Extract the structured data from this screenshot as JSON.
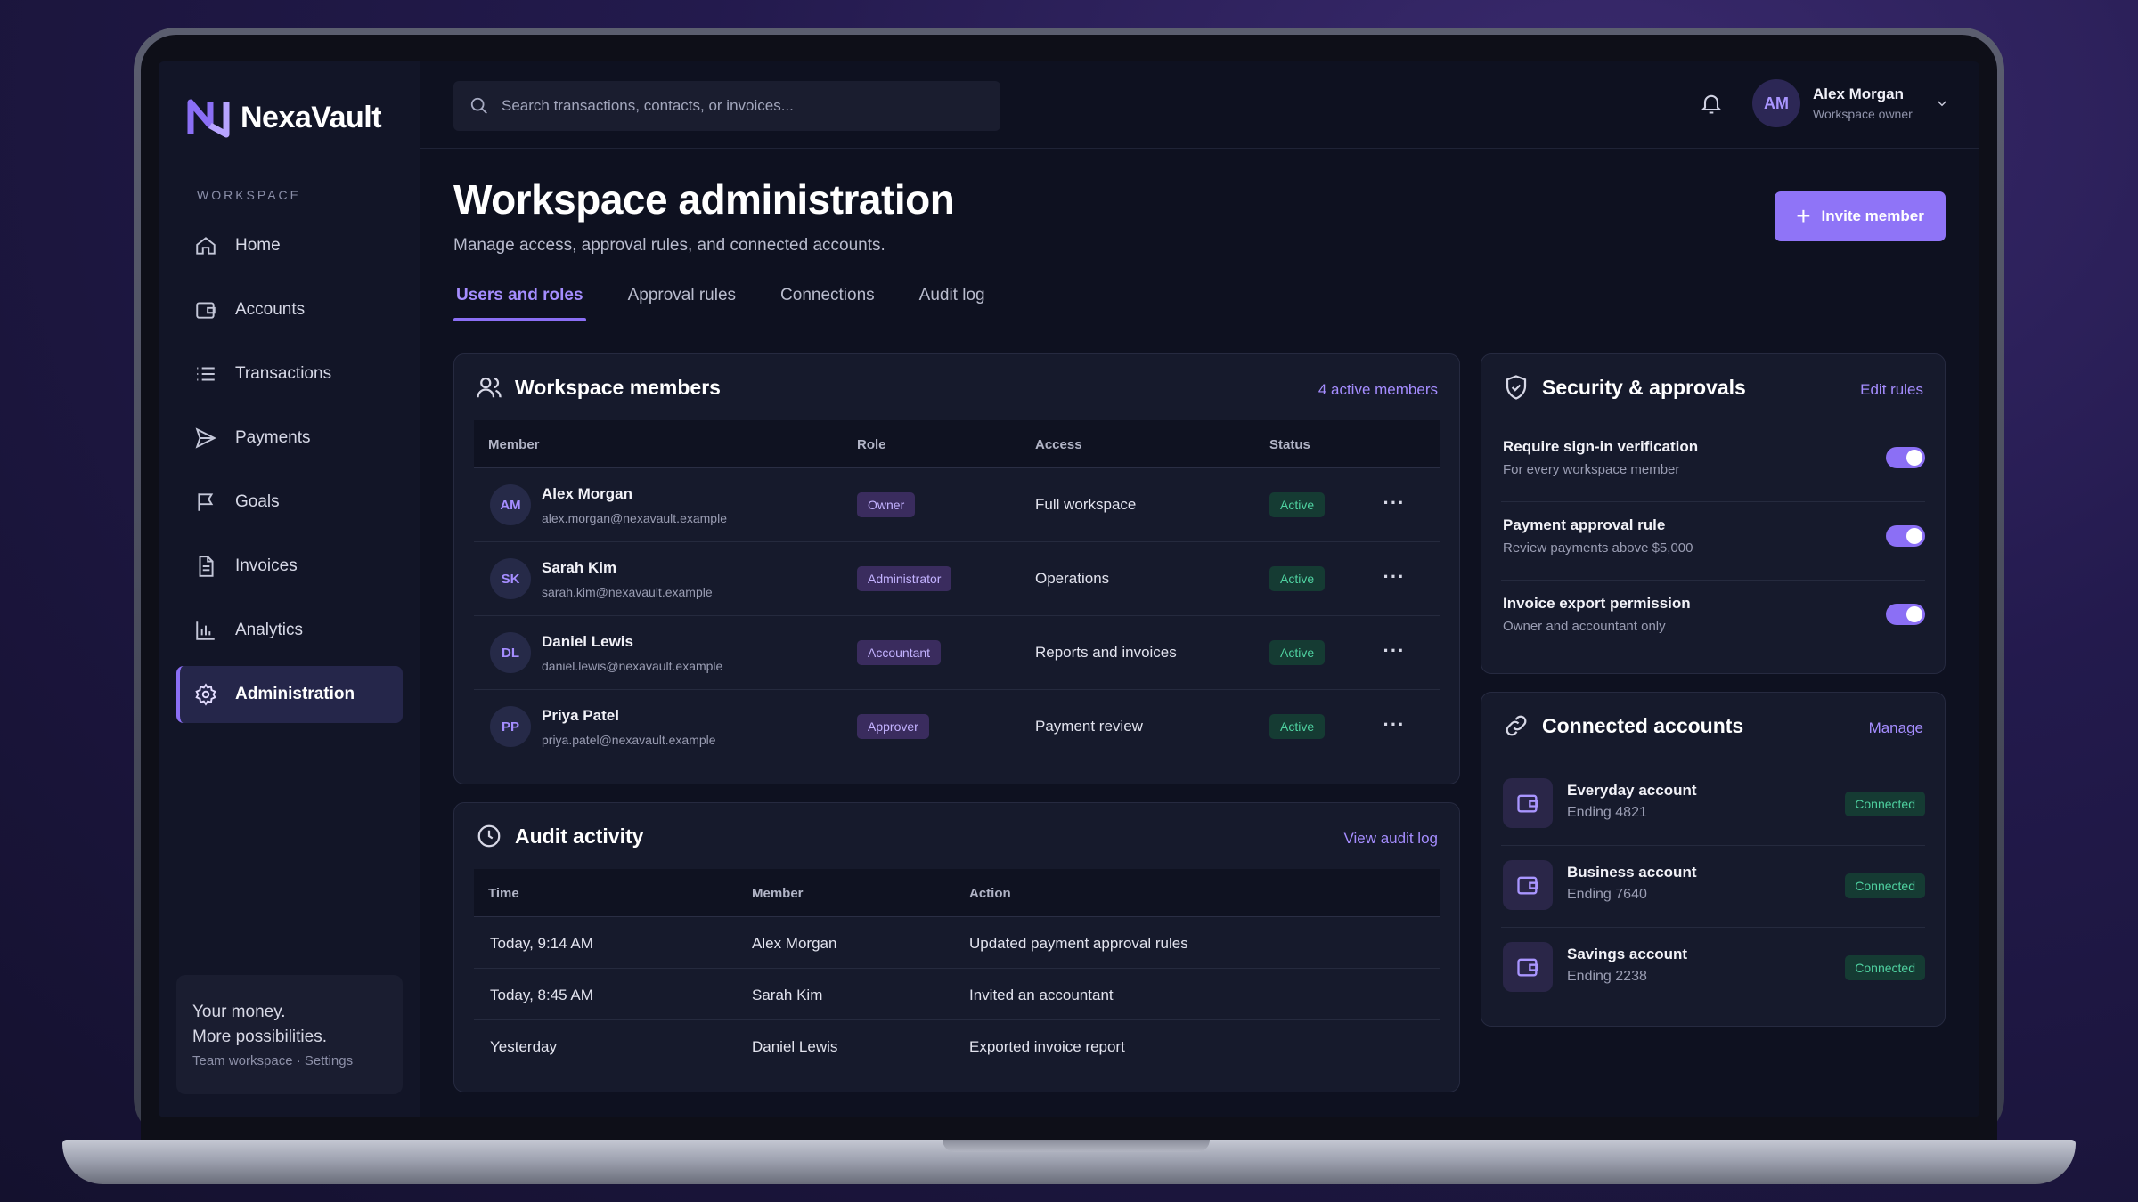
{
  "brand": {
    "name": "NexaVault"
  },
  "sidebar": {
    "section_label": "WORKSPACE",
    "items": [
      {
        "label": "Home",
        "icon": "home-icon"
      },
      {
        "label": "Accounts",
        "icon": "wallet-icon"
      },
      {
        "label": "Transactions",
        "icon": "list-icon"
      },
      {
        "label": "Payments",
        "icon": "send-icon"
      },
      {
        "label": "Goals",
        "icon": "flag-icon"
      },
      {
        "label": "Invoices",
        "icon": "document-icon"
      },
      {
        "label": "Analytics",
        "icon": "bar-chart-icon"
      },
      {
        "label": "Administration",
        "icon": "gear-icon",
        "active": true
      }
    ],
    "footer": {
      "line1": "Your money.",
      "line2": "More possibilities.",
      "line3": "Team workspace · Settings"
    }
  },
  "topbar": {
    "search_placeholder": "Search transactions, contacts, or invoices...",
    "user": {
      "initials": "AM",
      "name": "Alex Morgan",
      "role": "Workspace owner"
    }
  },
  "page": {
    "title": "Workspace administration",
    "subtitle": "Manage access, approval rules, and connected accounts.",
    "invite_label": "Invite member",
    "tabs": [
      {
        "label": "Users and roles",
        "active": true
      },
      {
        "label": "Approval rules"
      },
      {
        "label": "Connections"
      },
      {
        "label": "Audit log"
      }
    ]
  },
  "members": {
    "title": "Workspace members",
    "count_link": "4 active members",
    "columns": [
      "Member",
      "Role",
      "Access",
      "Status"
    ],
    "rows": [
      {
        "initials": "AM",
        "name": "Alex Morgan",
        "email": "alex.morgan@nexavault.example",
        "role": "Owner",
        "access": "Full workspace",
        "status": "Active"
      },
      {
        "initials": "SK",
        "name": "Sarah Kim",
        "email": "sarah.kim@nexavault.example",
        "role": "Administrator",
        "access": "Operations",
        "status": "Active"
      },
      {
        "initials": "DL",
        "name": "Daniel Lewis",
        "email": "daniel.lewis@nexavault.example",
        "role": "Accountant",
        "access": "Reports and invoices",
        "status": "Active"
      },
      {
        "initials": "PP",
        "name": "Priya Patel",
        "email": "priya.patel@nexavault.example",
        "role": "Approver",
        "access": "Payment review",
        "status": "Active"
      }
    ]
  },
  "audit": {
    "title": "Audit activity",
    "link": "View audit log",
    "columns": [
      "Time",
      "Member",
      "Action"
    ],
    "rows": [
      {
        "time": "Today, 9:14 AM",
        "member": "Alex Morgan",
        "action": "Updated payment approval rules"
      },
      {
        "time": "Today, 8:45 AM",
        "member": "Sarah Kim",
        "action": "Invited an accountant"
      },
      {
        "time": "Yesterday",
        "member": "Daniel Lewis",
        "action": "Exported invoice report"
      }
    ]
  },
  "security": {
    "title": "Security & approvals",
    "link": "Edit rules",
    "rules": [
      {
        "title": "Require sign-in verification",
        "sub": "For every workspace member",
        "enabled": true
      },
      {
        "title": "Payment approval rule",
        "sub": "Review payments above $5,000",
        "enabled": true
      },
      {
        "title": "Invoice export permission",
        "sub": "Owner and accountant only",
        "enabled": true
      }
    ]
  },
  "connected": {
    "title": "Connected accounts",
    "link": "Manage",
    "accounts": [
      {
        "name": "Everyday account",
        "sub": "Ending 4821",
        "status": "Connected"
      },
      {
        "name": "Business account",
        "sub": "Ending 7640",
        "status": "Connected"
      },
      {
        "name": "Savings account",
        "sub": "Ending 2238",
        "status": "Connected"
      }
    ]
  },
  "colors": {
    "accent": "#8f74f7",
    "success": "#4fd1a0",
    "background": "#0e1120"
  }
}
